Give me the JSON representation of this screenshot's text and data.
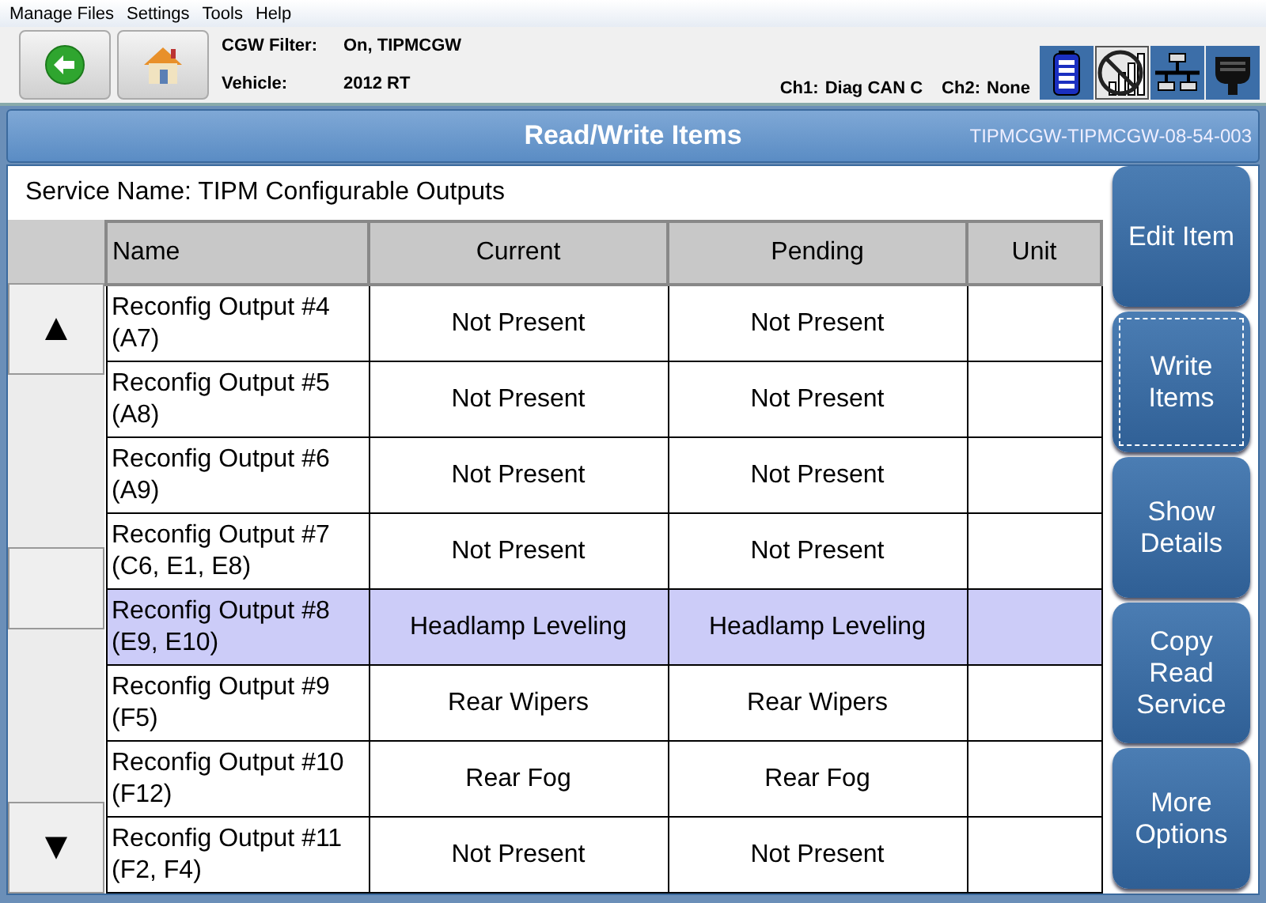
{
  "menu": [
    "Manage Files",
    "Settings",
    "Tools",
    "Help"
  ],
  "toolbar": {
    "info": [
      {
        "label": "CGW Filter:",
        "value": "On, TIPMCGW"
      },
      {
        "label": "Vehicle:",
        "value": "2012 RT"
      }
    ],
    "channels": [
      {
        "label": "Ch1:",
        "value": "Diag CAN C"
      },
      {
        "label": "Ch2:",
        "value": "None"
      }
    ]
  },
  "title": "Read/Write Items",
  "title_id": "TIPMCGW-TIPMCGW-08-54-003",
  "service": "Service Name:  TIPM Configurable Outputs",
  "scroll": {
    "up": "▲",
    "down": "▼"
  },
  "table": {
    "columns": [
      "Name",
      "Current",
      "Pending",
      "Unit"
    ],
    "rows": [
      {
        "name": "Reconfig Output #4 (A7)",
        "current": "Not Present",
        "pending": "Not Present",
        "selected": false
      },
      {
        "name": "Reconfig Output #5 (A8)",
        "current": "Not Present",
        "pending": "Not Present",
        "selected": false
      },
      {
        "name": "Reconfig Output #6 (A9)",
        "current": "Not Present",
        "pending": "Not Present",
        "selected": false
      },
      {
        "name": "Reconfig Output #7 (C6, E1, E8)",
        "current": "Not Present",
        "pending": "Not Present",
        "selected": false
      },
      {
        "name": "Reconfig Output #8 (E9, E10)",
        "current": "Headlamp Leveling",
        "pending": "Headlamp Leveling",
        "selected": true
      },
      {
        "name": "Reconfig Output #9 (F5)",
        "current": "Rear Wipers",
        "pending": "Rear Wipers",
        "selected": false
      },
      {
        "name": "Reconfig Output #10 (F12)",
        "current": "Rear Fog",
        "pending": "Rear Fog",
        "selected": false
      },
      {
        "name": "Reconfig Output #11 (F2, F4)",
        "current": "Not Present",
        "pending": "Not Present",
        "selected": false
      }
    ]
  },
  "actions": [
    {
      "label": "Edit Item",
      "focused": false
    },
    {
      "label": "Write Items",
      "focused": true
    },
    {
      "label": "Show Details",
      "focused": false
    },
    {
      "label": "Copy Read Service",
      "focused": false
    },
    {
      "label": "More Options",
      "focused": false
    }
  ]
}
